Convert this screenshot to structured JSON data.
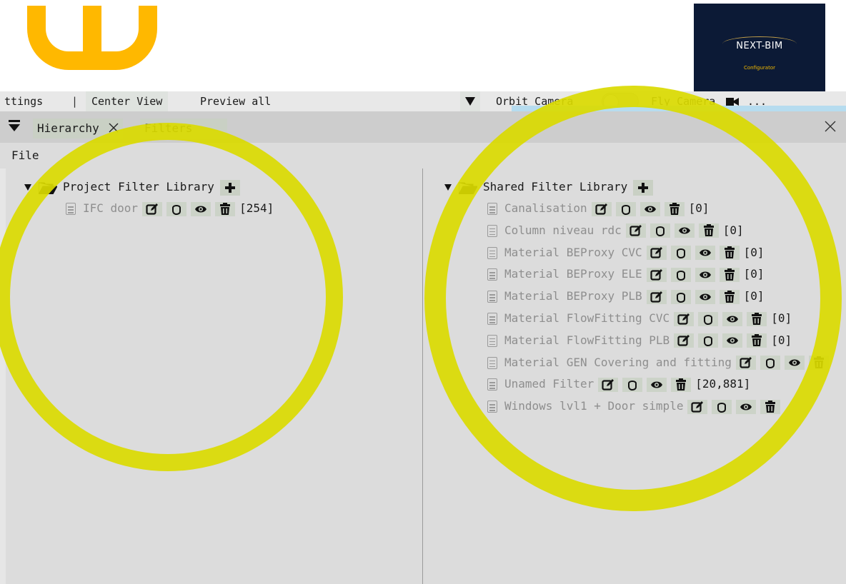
{
  "toolbar": {
    "settings": "ttings",
    "separator": "|",
    "center_view": "Center View",
    "preview_all": "Preview all",
    "orbit_camera": "Orbit Camera",
    "fly_camera": "Fly Camera",
    "more": "..."
  },
  "logo_right": {
    "name": "NEXT-BIM",
    "subtitle": "Configurator"
  },
  "tabs": [
    {
      "label": "Hierarchy",
      "closable": true
    },
    {
      "label": "Filters",
      "closable": false
    }
  ],
  "menu": {
    "file": "File"
  },
  "project_library": {
    "title": "Project Filter Library",
    "items": [
      {
        "name": "IFC door",
        "count": "[254]"
      }
    ]
  },
  "shared_library": {
    "title": "Shared Filter Library",
    "items": [
      {
        "name": "Canalisation",
        "count": "[0]"
      },
      {
        "name": "Column niveau rdc",
        "count": "[0]"
      },
      {
        "name": "Material BEProxy CVC",
        "count": "[0]"
      },
      {
        "name": "Material BEProxy ELE",
        "count": "[0]"
      },
      {
        "name": "Material BEProxy PLB",
        "count": "[0]"
      },
      {
        "name": "Material FlowFitting CVC",
        "count": "[0]"
      },
      {
        "name": "Material FlowFitting PLB",
        "count": "[0]"
      },
      {
        "name": "Material GEN Covering and fitting",
        "count": ""
      },
      {
        "name": "Unamed Filter",
        "count": "[20,881]"
      },
      {
        "name": "Windows lvl1 + Door simple",
        "count": ""
      }
    ]
  },
  "icons": {
    "row_actions": [
      "edit-icon",
      "select-hand-icon",
      "eye-icon",
      "trash-icon"
    ],
    "logo_left": "yellow-b-logo",
    "camera": "video-camera-icon"
  },
  "colors": {
    "highlight": "#dada00",
    "logo_yellow": "#ffb800",
    "logo_navy": "#0c1a36",
    "accent_blue": "#b6dcef"
  }
}
